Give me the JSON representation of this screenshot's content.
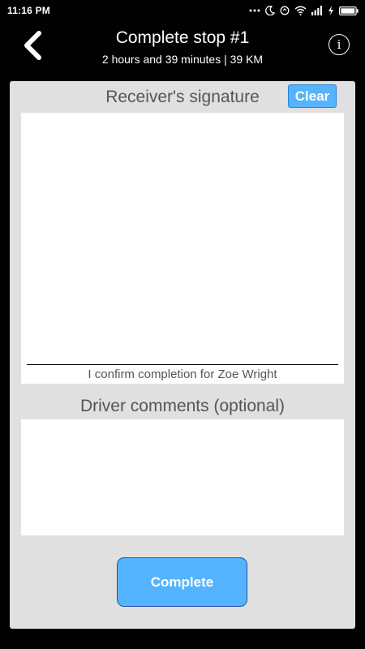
{
  "status_bar": {
    "time": "11:16 PM",
    "icons": [
      "more-dots-icon",
      "moon-icon",
      "sync-icon",
      "wifi-icon",
      "signal-icon",
      "charging-icon",
      "battery-icon"
    ]
  },
  "header": {
    "title": "Complete stop #1",
    "subtitle": "2 hours and 39 minutes | 39 KM",
    "back_icon": "chevron-left-icon",
    "info_icon": "i"
  },
  "signature": {
    "heading": "Receiver's signature",
    "clear_label": "Clear",
    "caption": "I confirm completion for Zoe Wright"
  },
  "comments": {
    "heading": "Driver comments (optional)",
    "value": ""
  },
  "actions": {
    "complete_label": "Complete"
  },
  "colors": {
    "accent": "#55b4ff",
    "card": "#e0e0e0",
    "background": "#000000"
  }
}
